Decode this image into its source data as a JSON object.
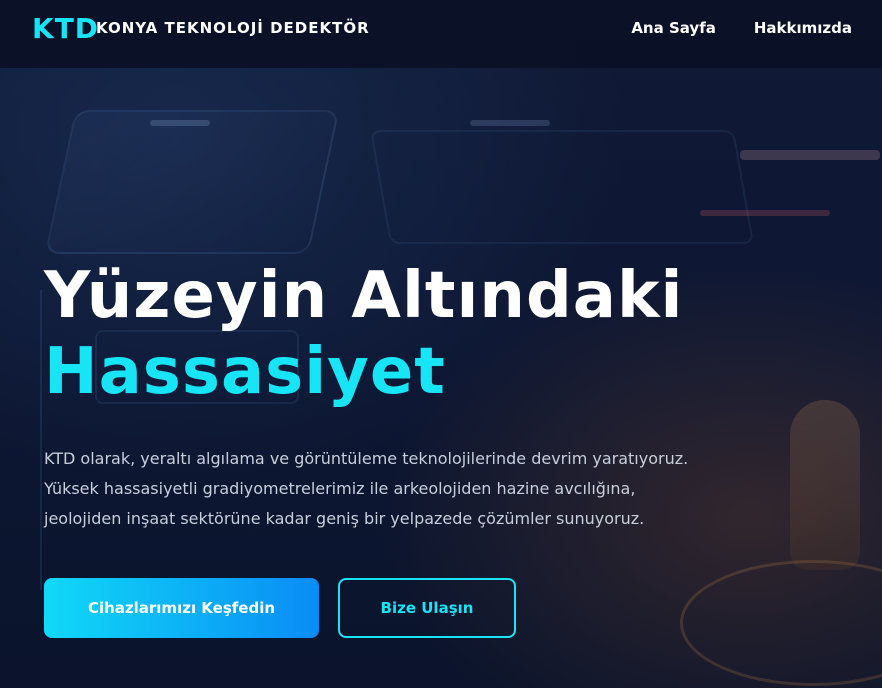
{
  "brand": {
    "logo": "KTD",
    "name": "KONYA TEKNOLOJİ DEDEKTÖR"
  },
  "nav": {
    "items": [
      {
        "label": "Ana Sayfa"
      },
      {
        "label": "Hakkımızda"
      }
    ]
  },
  "hero": {
    "title_line1": "Yüzeyin Altındaki",
    "title_line2": "Hassasiyet",
    "description": [
      "KTD olarak, yeraltı algılama ve görüntüleme teknolojilerinde devrim yaratıyoruz.",
      "Yüksek hassasiyetli gradiyometrelerimiz ile arkeolojiden hazine avcılığına,",
      "jeolojiden inşaat sektörüne kadar geniş bir yelpazede çözümler sunuyoruz."
    ],
    "primary_button": "Cihazlarımızı Keşfedin",
    "secondary_button": "Bize Ulaşın"
  },
  "colors": {
    "accent": "#17e4f5",
    "background": "#0c1630",
    "button_gradient_start": "#10d9f7",
    "button_gradient_end": "#0a8cf5"
  }
}
